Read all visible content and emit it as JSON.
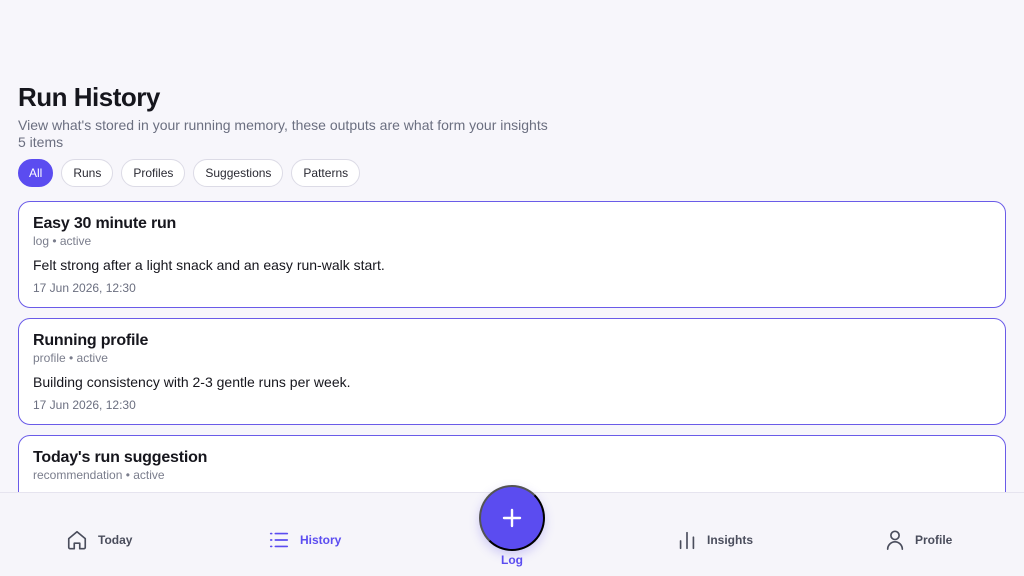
{
  "header": {
    "title": "Run History",
    "subtitle": "View what's stored in your running memory, these outputs are what form your insights",
    "count": "5 items"
  },
  "filters": [
    {
      "label": "All",
      "active": true
    },
    {
      "label": "Runs",
      "active": false
    },
    {
      "label": "Profiles",
      "active": false
    },
    {
      "label": "Suggestions",
      "active": false
    },
    {
      "label": "Patterns",
      "active": false
    }
  ],
  "cards": [
    {
      "title": "Easy 30 minute run",
      "meta": "log • active",
      "body": "Felt strong after a light snack and an easy run-walk start.",
      "date": "17 Jun 2026, 12:30"
    },
    {
      "title": "Running profile",
      "meta": "profile • active",
      "body": "Building consistency with 2-3 gentle runs per week.",
      "date": "17 Jun 2026, 12:30"
    },
    {
      "title": "Today's run suggestion",
      "meta": "recommendation • active",
      "body": "",
      "date": ""
    }
  ],
  "nav": {
    "today": "Today",
    "history": "History",
    "log": "Log",
    "insights": "Insights",
    "profile": "Profile"
  },
  "icons": {
    "today": "home-icon",
    "history": "list-icon",
    "log": "plus-icon",
    "insights": "bar-chart-icon",
    "profile": "user-icon"
  },
  "colors": {
    "accent": "#5b4cf0",
    "card_border": "#6a5be8",
    "background": "#f7f6fb"
  }
}
